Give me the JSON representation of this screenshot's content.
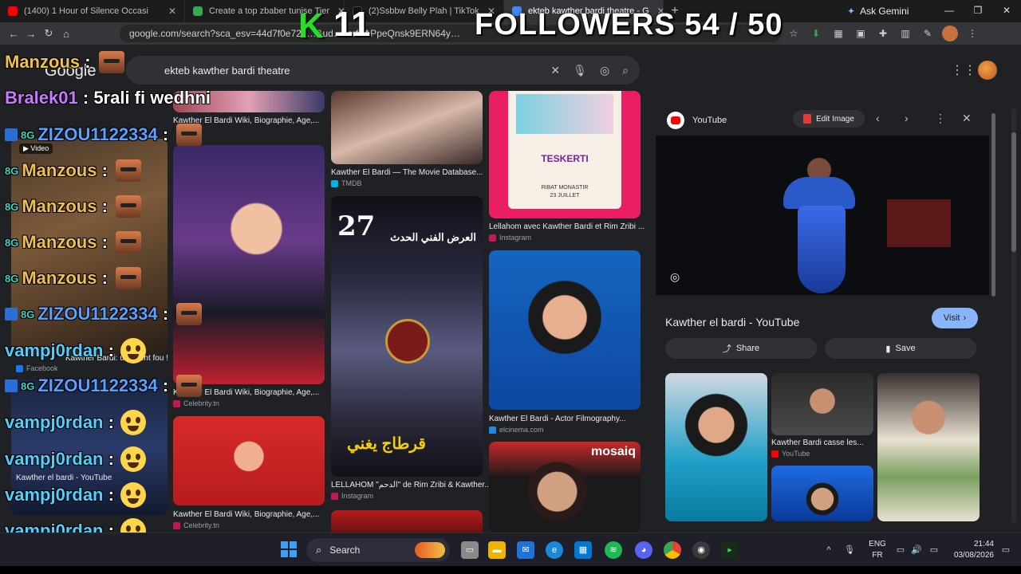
{
  "browser": {
    "tabs": [
      {
        "label": "(1400) 1 Hour of Silence Occasi",
        "color": "#ff0000"
      },
      {
        "label": "Create a top zbaber tunise Tier",
        "color": "#34a853"
      },
      {
        "label": "(2)Ssbbw Belly Plah | TikTok",
        "color": "#111111"
      },
      {
        "label": "ekteb kawther bardi theatre - G",
        "color": "#4285f4"
      }
    ],
    "ask_gemini": "Ask Gemini",
    "url": "google.com/search?sca_esv=44d7f0e726…&ud…xsrf=APpeQnsk9ERN64y…"
  },
  "google": {
    "logo": "Google",
    "query": "ekteb kawther bardi theatre",
    "results": [
      {
        "caption": "Kawther El Bardi Wiki, Biographie, Age,...",
        "source": "Celebrity.tn"
      },
      {
        "caption": "Kawther El Bardi — The Movie Database...",
        "source": "TMDB"
      },
      {
        "caption": "Lellahom avec Kawther Bardi et Rim Zribi ...",
        "source": "Instagram"
      },
      {
        "caption": "Kawther El Bardi Wiki, Biographie, Age,...",
        "source": "Celebrity.tn"
      },
      {
        "caption": "LELLAHOM \"الدحم\" de Rim Zribi & Kawther...",
        "source": "Instagram"
      },
      {
        "caption": "Kawther El Bardi - Actor Filmography...",
        "source": "elcinema.com"
      },
      {
        "caption": "Kawther El Bardi Wiki, Biographie, Age,...",
        "source": "Celebrity.tn"
      },
      {
        "caption": "Kawther el bardi - YouTube",
        "source": "YouTube"
      },
      {
        "caption": "Kawther Bardi: un talent fou !",
        "source": "Facebook"
      }
    ],
    "poster_big_number": "27",
    "poster_arabic": "العرض الفني الحدث",
    "poster_bottom": "قرطاج يغني",
    "teskerti": "TESKERTI",
    "teskerti_place": "RIBAT MONASTIR",
    "teskerti_date": "23 JUILLET",
    "mosaique": "mosaiq"
  },
  "panel": {
    "source": "YouTube",
    "edit_image": "Edit Image",
    "title": "Kawther el bardi - YouTube",
    "visit": "Visit",
    "share": "Share",
    "save": "Save",
    "related_caption": "Kawther Bardi casse les...",
    "related_source": "YouTube"
  },
  "overlay": {
    "followers": "FOLLOWERS 54 / 50",
    "k_letter": "K",
    "k_number": "11",
    "chat": [
      {
        "user": "Manzous",
        "color": "#f0c14a",
        "msg": "",
        "emote": "face"
      },
      {
        "user": "Bralek01",
        "color": "#c779ff",
        "msg": "5rali fi wedhni",
        "emote": ""
      },
      {
        "user": "ZIZOU1122334",
        "color": "#5aa0ff",
        "msg": "",
        "emote": "face"
      },
      {
        "user": "Manzous",
        "color": "#f0c14a",
        "msg": "",
        "emote": "face"
      },
      {
        "user": "Manzous",
        "color": "#f0c14a",
        "msg": "",
        "emote": "face"
      },
      {
        "user": "Manzous",
        "color": "#f0c14a",
        "msg": "",
        "emote": "face"
      },
      {
        "user": "Manzous",
        "color": "#f0c14a",
        "msg": "",
        "emote": "face"
      },
      {
        "user": "ZIZOU1122334",
        "color": "#5aa0ff",
        "msg": "",
        "emote": "face"
      },
      {
        "user": "vampj0rdan",
        "color": "#4fd0ff",
        "msg": "",
        "emote": "laugh"
      },
      {
        "user": "ZIZOU1122334",
        "color": "#5aa0ff",
        "msg": "",
        "emote": "face"
      },
      {
        "user": "vampj0rdan",
        "color": "#4fd0ff",
        "msg": "",
        "emote": "laugh"
      },
      {
        "user": "vampj0rdan",
        "color": "#4fd0ff",
        "msg": "",
        "emote": "laugh"
      },
      {
        "user": "vampj0rdan",
        "color": "#4fd0ff",
        "msg": "",
        "emote": "laugh"
      },
      {
        "user": "vampj0rdan",
        "color": "#4fd0ff",
        "msg": "",
        "emote": "laugh"
      }
    ],
    "video_badge": "Video"
  },
  "taskbar": {
    "search": "Search",
    "lang_1": "ENG",
    "lang_2": "FR",
    "time": "21:44",
    "date": "03/08/2026"
  }
}
